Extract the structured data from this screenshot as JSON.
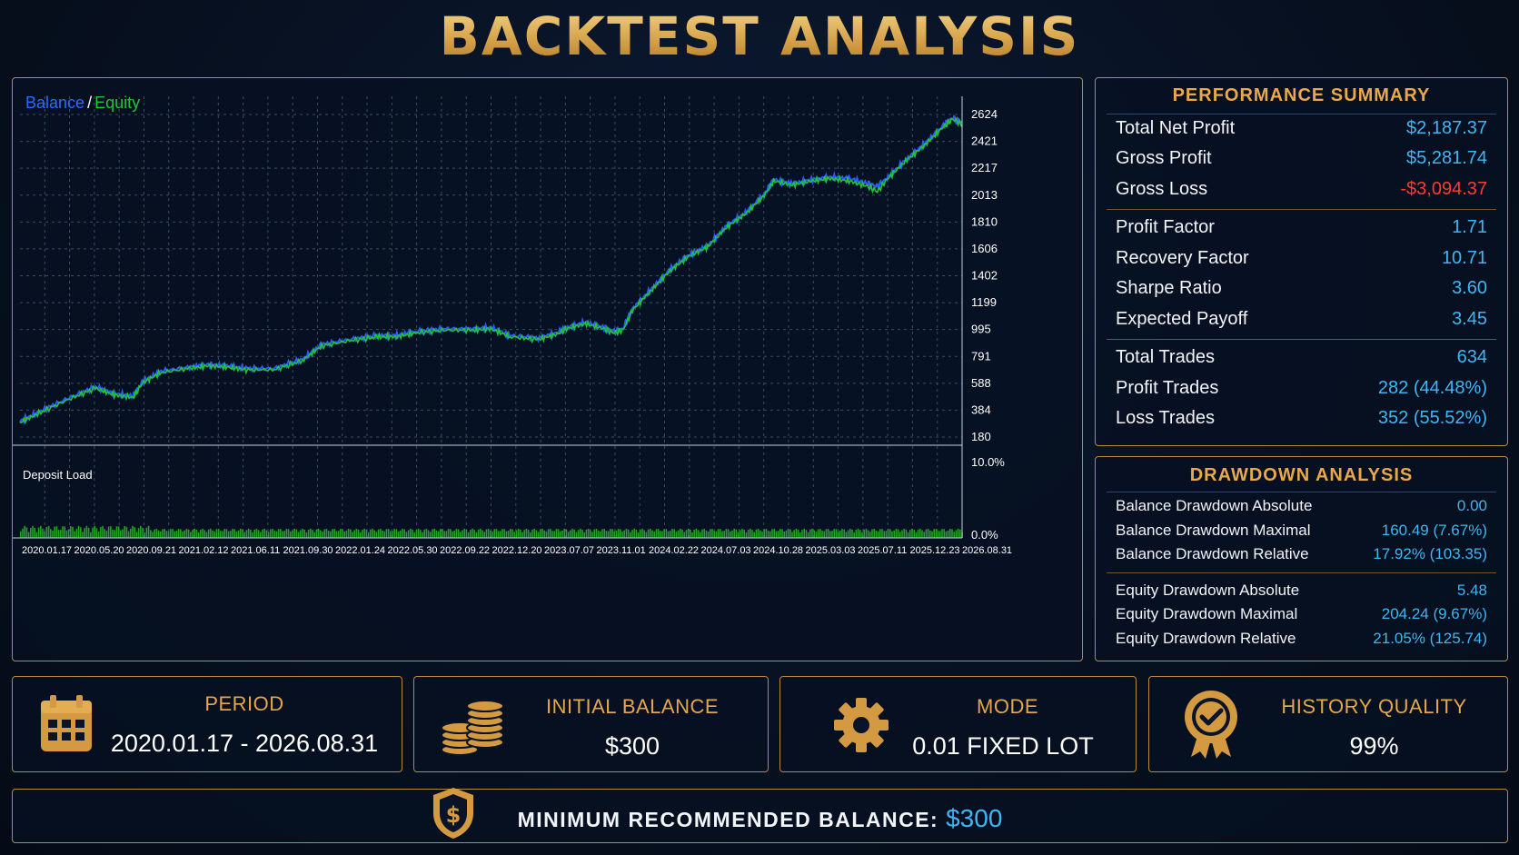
{
  "title": "BACKTEST ANALYSIS",
  "chart": {
    "legend_balance": "Balance",
    "legend_sep": "/",
    "legend_equity": "Equity",
    "deposit_load_label": "Deposit Load",
    "colors": {
      "balance": "#2b5cff",
      "equity": "#22c33b",
      "deposit": "#1fa51f",
      "grid": "#3a4c66",
      "axis_text": "#ffffff"
    }
  },
  "chart_data": {
    "type": "line",
    "y_ticks": [
      "2624",
      "2421",
      "2217",
      "2013",
      "1810",
      "1606",
      "1402",
      "1199",
      "995",
      "791",
      "588",
      "384",
      "180"
    ],
    "ylim": [
      180,
      2624
    ],
    "x_ticks": [
      "2020.01.17",
      "2020.05.20",
      "2020.09.21",
      "2021.02.12",
      "2021.06.11",
      "2021.09.30",
      "2022.01.24",
      "2022.05.30",
      "2022.09.22",
      "2022.12.20",
      "2023.07.07",
      "2023.11.01",
      "2024.02.22",
      "2024.07.03",
      "2024.10.28",
      "2025.03.03",
      "2025.07.11",
      "2025.12.23",
      "2026.08.31"
    ],
    "series": [
      {
        "name": "Balance",
        "points": [
          [
            0,
            300
          ],
          [
            0.02,
            370
          ],
          [
            0.05,
            470
          ],
          [
            0.08,
            560
          ],
          [
            0.1,
            510
          ],
          [
            0.12,
            490
          ],
          [
            0.13,
            600
          ],
          [
            0.15,
            680
          ],
          [
            0.18,
            710
          ],
          [
            0.2,
            730
          ],
          [
            0.22,
            720
          ],
          [
            0.24,
            700
          ],
          [
            0.27,
            700
          ],
          [
            0.3,
            770
          ],
          [
            0.32,
            880
          ],
          [
            0.35,
            920
          ],
          [
            0.38,
            950
          ],
          [
            0.4,
            950
          ],
          [
            0.42,
            980
          ],
          [
            0.45,
            1000
          ],
          [
            0.48,
            1000
          ],
          [
            0.5,
            1010
          ],
          [
            0.52,
            950
          ],
          [
            0.55,
            930
          ],
          [
            0.57,
            970
          ],
          [
            0.58,
            1010
          ],
          [
            0.6,
            1050
          ],
          [
            0.62,
            1010
          ],
          [
            0.63,
            980
          ],
          [
            0.64,
            1000
          ],
          [
            0.65,
            1150
          ],
          [
            0.67,
            1300
          ],
          [
            0.69,
            1450
          ],
          [
            0.71,
            1560
          ],
          [
            0.73,
            1630
          ],
          [
            0.75,
            1780
          ],
          [
            0.77,
            1880
          ],
          [
            0.79,
            2020
          ],
          [
            0.8,
            2130
          ],
          [
            0.82,
            2100
          ],
          [
            0.84,
            2130
          ],
          [
            0.86,
            2150
          ],
          [
            0.88,
            2140
          ],
          [
            0.9,
            2100
          ],
          [
            0.91,
            2080
          ],
          [
            0.92,
            2140
          ],
          [
            0.94,
            2280
          ],
          [
            0.96,
            2400
          ],
          [
            0.98,
            2540
          ],
          [
            0.99,
            2600
          ],
          [
            1.0,
            2560
          ]
        ]
      },
      {
        "name": "Equity",
        "points": [
          [
            0,
            290
          ],
          [
            0.02,
            360
          ],
          [
            0.05,
            460
          ],
          [
            0.08,
            550
          ],
          [
            0.1,
            500
          ],
          [
            0.12,
            480
          ],
          [
            0.13,
            590
          ],
          [
            0.15,
            670
          ],
          [
            0.18,
            700
          ],
          [
            0.2,
            720
          ],
          [
            0.22,
            710
          ],
          [
            0.24,
            690
          ],
          [
            0.27,
            690
          ],
          [
            0.3,
            760
          ],
          [
            0.32,
            870
          ],
          [
            0.35,
            910
          ],
          [
            0.38,
            940
          ],
          [
            0.4,
            940
          ],
          [
            0.42,
            970
          ],
          [
            0.45,
            990
          ],
          [
            0.48,
            990
          ],
          [
            0.5,
            1000
          ],
          [
            0.52,
            940
          ],
          [
            0.55,
            920
          ],
          [
            0.57,
            960
          ],
          [
            0.58,
            1000
          ],
          [
            0.6,
            1040
          ],
          [
            0.62,
            1000
          ],
          [
            0.63,
            970
          ],
          [
            0.64,
            990
          ],
          [
            0.65,
            1140
          ],
          [
            0.67,
            1290
          ],
          [
            0.69,
            1440
          ],
          [
            0.71,
            1550
          ],
          [
            0.73,
            1620
          ],
          [
            0.75,
            1770
          ],
          [
            0.77,
            1870
          ],
          [
            0.79,
            2010
          ],
          [
            0.8,
            2120
          ],
          [
            0.82,
            2090
          ],
          [
            0.84,
            2120
          ],
          [
            0.86,
            2140
          ],
          [
            0.88,
            2120
          ],
          [
            0.9,
            2080
          ],
          [
            0.91,
            2040
          ],
          [
            0.92,
            2130
          ],
          [
            0.94,
            2270
          ],
          [
            0.96,
            2390
          ],
          [
            0.98,
            2530
          ],
          [
            0.99,
            2590
          ],
          [
            1.0,
            2550
          ]
        ]
      }
    ],
    "deposit_load": {
      "y_ticks": [
        "10.0%",
        "0.0%"
      ],
      "ylim": [
        0,
        10
      ],
      "typical_value": 1.0
    }
  },
  "performance": {
    "heading": "PERFORMANCE SUMMARY",
    "groups": [
      [
        {
          "label": "Total Net Profit",
          "value": "$2,187.37",
          "tone": "pos"
        },
        {
          "label": "Gross Profit",
          "value": "$5,281.74",
          "tone": "pos"
        },
        {
          "label": "Gross Loss",
          "value": "-$3,094.37",
          "tone": "neg"
        }
      ],
      [
        {
          "label": "Profit Factor",
          "value": "1.71",
          "tone": "pos"
        },
        {
          "label": "Recovery Factor",
          "value": "10.71",
          "tone": "pos"
        },
        {
          "label": "Sharpe Ratio",
          "value": "3.60",
          "tone": "pos"
        },
        {
          "label": "Expected Payoff",
          "value": "3.45",
          "tone": "pos"
        }
      ],
      [
        {
          "label": "Total Trades",
          "value": "634",
          "tone": "pos"
        },
        {
          "label": "Profit Trades",
          "value": "282 (44.48%)",
          "tone": "pos"
        },
        {
          "label": "Loss Trades",
          "value": "352 (55.52%)",
          "tone": "pos"
        }
      ]
    ]
  },
  "drawdown": {
    "heading": "DRAWDOWN ANALYSIS",
    "groups": [
      [
        {
          "label": "Balance Drawdown Absolute",
          "value": "0.00"
        },
        {
          "label": "Balance Drawdown Maximal",
          "value": "160.49 (7.67%)"
        },
        {
          "label": "Balance Drawdown Relative",
          "value": "17.92% (103.35)"
        }
      ],
      [
        {
          "label": "Equity Drawdown Absolute",
          "value": "5.48"
        },
        {
          "label": "Equity Drawdown Maximal",
          "value": "204.24 (9.67%)"
        },
        {
          "label": "Equity Drawdown Relative",
          "value": "21.05% (125.74)"
        }
      ]
    ]
  },
  "cards": {
    "period": {
      "title": "PERIOD",
      "value": "2020.01.17 - 2026.08.31",
      "icon": "calendar-icon"
    },
    "initial_balance": {
      "title": "INITIAL BALANCE",
      "value": "$300",
      "icon": "coins-icon"
    },
    "mode": {
      "title": "MODE",
      "value": "0.01 FIXED LOT",
      "icon": "gear-icon"
    },
    "history_quality": {
      "title": "HISTORY QUALITY",
      "value": "99%",
      "icon": "award-badge-icon"
    }
  },
  "banner": {
    "label": "MINIMUM RECOMMENDED BALANCE:",
    "value": "$300",
    "icon": "shield-dollar-icon"
  },
  "accent": {
    "gold": "#d9a24a",
    "blue_value": "#3fb6f2",
    "negative": "#ff3b30"
  }
}
